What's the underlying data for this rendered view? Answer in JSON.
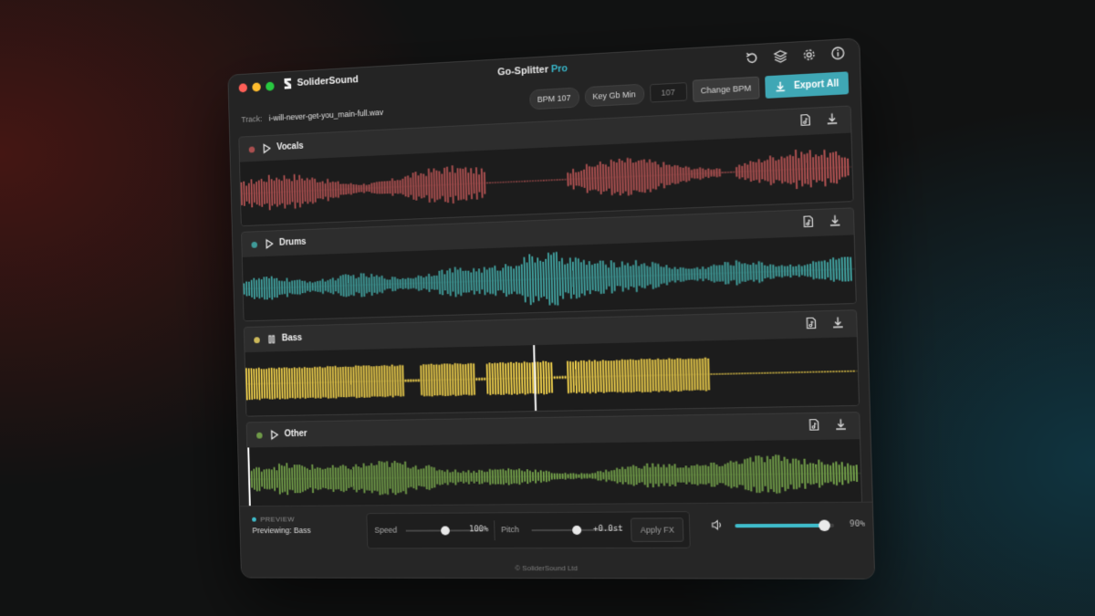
{
  "window": {
    "logo_text": "SoliderSound",
    "title": "Go-Splitter",
    "title_badge": "Pro"
  },
  "track": {
    "label": "Track:",
    "filename": "i-will-never-get-you_main-full.wav"
  },
  "controls": {
    "bpm_badge": "BPM 107",
    "key_badge": "Key Gb Min",
    "bpm_input_value": "107",
    "change_bpm_label": "Change BPM",
    "export_all_label": "Export All"
  },
  "top_icons": [
    "refresh-icon",
    "layers-icon",
    "settings-gear-icon",
    "info-icon"
  ],
  "stems": [
    {
      "name": "Vocals",
      "color": "#a94f4f",
      "state": "play"
    },
    {
      "name": "Drums",
      "color": "#3f9a98",
      "state": "play"
    },
    {
      "name": "Bass",
      "color": "#e6c84a",
      "state": "pause",
      "playhead": 0.49
    },
    {
      "name": "Other",
      "color": "#6f9a48",
      "state": "play",
      "playhead": 0.0
    }
  ],
  "preview": {
    "tag": "PREVIEW",
    "text": "Previewing: Bass"
  },
  "fx": {
    "speed_label": "Speed",
    "speed_value": "100%",
    "speed_position": 0.5,
    "pitch_label": "Pitch",
    "pitch_value": "+0.0st",
    "pitch_position": 0.5,
    "apply_label": "Apply FX"
  },
  "volume": {
    "value": "90%",
    "level": 0.9
  },
  "footer": "© SoliderSound Ltd",
  "accent_color": "#3fa7b5"
}
